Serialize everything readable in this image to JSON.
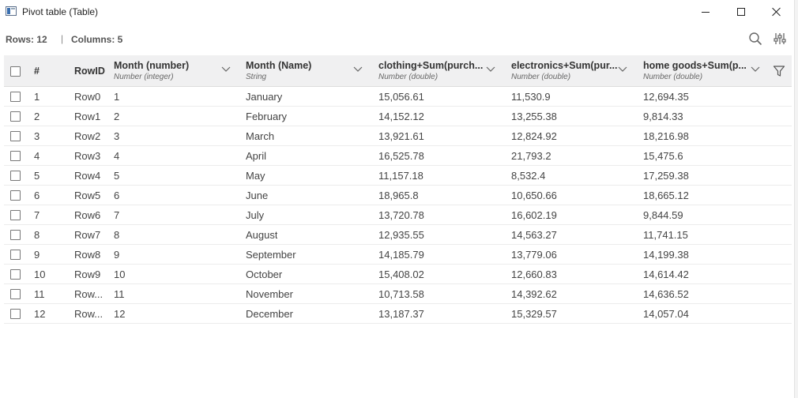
{
  "window": {
    "title": "Pivot table (Table)"
  },
  "status": {
    "rows_label": "Rows: 12",
    "separator": "|",
    "columns_label": "Columns: 5"
  },
  "table": {
    "headers": {
      "row_num": "#",
      "row_id": "RowID",
      "month_number": {
        "title": "Month (number)",
        "type": "Number (integer)"
      },
      "month_name": {
        "title": "Month (Name)",
        "type": "String"
      },
      "clothing": {
        "title": "clothing+Sum(purch...",
        "type": "Number (double)"
      },
      "electronics": {
        "title": "electronics+Sum(pur...",
        "type": "Number (double)"
      },
      "home_goods": {
        "title": "home goods+Sum(p...",
        "type": "Number (double)"
      }
    },
    "rows": [
      {
        "n": "1",
        "id": "Row0",
        "mnum": "1",
        "mname": "January",
        "clothing": "15,056.61",
        "electronics": "11,530.9",
        "home": "12,694.35"
      },
      {
        "n": "2",
        "id": "Row1",
        "mnum": "2",
        "mname": "February",
        "clothing": "14,152.12",
        "electronics": "13,255.38",
        "home": "9,814.33"
      },
      {
        "n": "3",
        "id": "Row2",
        "mnum": "3",
        "mname": "March",
        "clothing": "13,921.61",
        "electronics": "12,824.92",
        "home": "18,216.98"
      },
      {
        "n": "4",
        "id": "Row3",
        "mnum": "4",
        "mname": "April",
        "clothing": "16,525.78",
        "electronics": "21,793.2",
        "home": "15,475.6"
      },
      {
        "n": "5",
        "id": "Row4",
        "mnum": "5",
        "mname": "May",
        "clothing": "11,157.18",
        "electronics": "8,532.4",
        "home": "17,259.38"
      },
      {
        "n": "6",
        "id": "Row5",
        "mnum": "6",
        "mname": "June",
        "clothing": "18,965.8",
        "electronics": "10,650.66",
        "home": "18,665.12"
      },
      {
        "n": "7",
        "id": "Row6",
        "mnum": "7",
        "mname": "July",
        "clothing": "13,720.78",
        "electronics": "16,602.19",
        "home": "9,844.59"
      },
      {
        "n": "8",
        "id": "Row7",
        "mnum": "8",
        "mname": "August",
        "clothing": "12,935.55",
        "electronics": "14,563.27",
        "home": "11,741.15"
      },
      {
        "n": "9",
        "id": "Row8",
        "mnum": "9",
        "mname": "September",
        "clothing": "14,185.79",
        "electronics": "13,779.06",
        "home": "14,199.38"
      },
      {
        "n": "10",
        "id": "Row9",
        "mnum": "10",
        "mname": "October",
        "clothing": "15,408.02",
        "electronics": "12,660.83",
        "home": "14,614.42"
      },
      {
        "n": "11",
        "id": "Row...",
        "mnum": "11",
        "mname": "November",
        "clothing": "10,713.58",
        "electronics": "14,392.62",
        "home": "14,636.52"
      },
      {
        "n": "12",
        "id": "Row...",
        "mnum": "12",
        "mname": "December",
        "clothing": "13,187.37",
        "electronics": "15,329.57",
        "home": "14,057.04"
      }
    ]
  },
  "icons": {
    "search": "search-icon",
    "settings": "column-settings-icon",
    "filter": "filter-icon",
    "chevron": "chevron-down-icon"
  }
}
